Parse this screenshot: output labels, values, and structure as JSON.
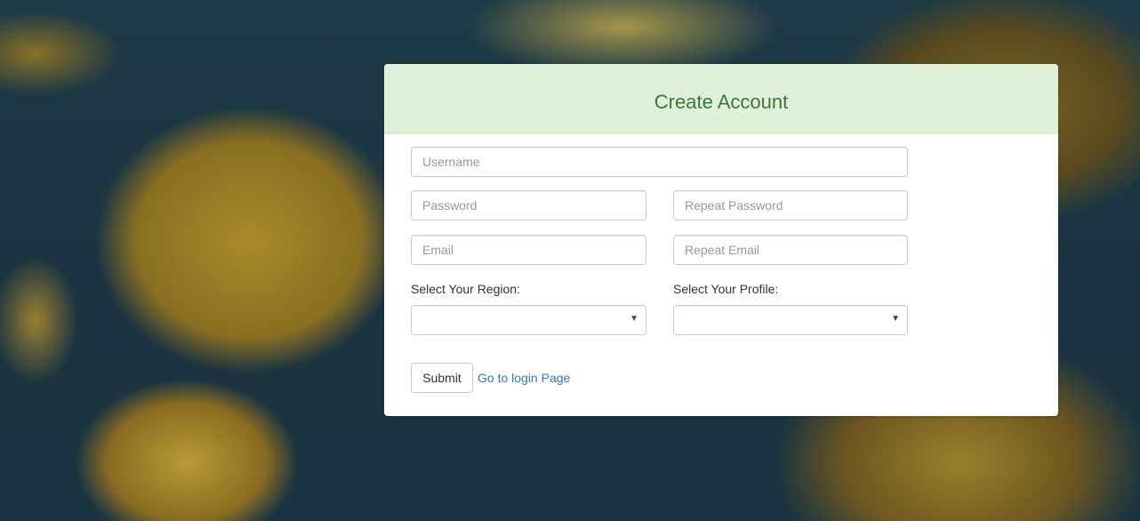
{
  "form": {
    "title": "Create Account",
    "username": {
      "placeholder": "Username",
      "value": ""
    },
    "password": {
      "placeholder": "Password",
      "value": ""
    },
    "repeat_password": {
      "placeholder": "Repeat Password",
      "value": ""
    },
    "email": {
      "placeholder": "Email",
      "value": ""
    },
    "repeat_email": {
      "placeholder": "Repeat Email",
      "value": ""
    },
    "region_label": "Select Your Region:",
    "region_selected": "",
    "profile_label": "Select Your Profile:",
    "profile_selected": "",
    "submit_label": "Submit",
    "login_link": "Go to login Page"
  },
  "icons": {
    "dropdown": "chevron-down-icon"
  },
  "colors": {
    "heading_bg": "#dff0d8",
    "heading_text": "#3c763d",
    "link": "#337ab7"
  }
}
